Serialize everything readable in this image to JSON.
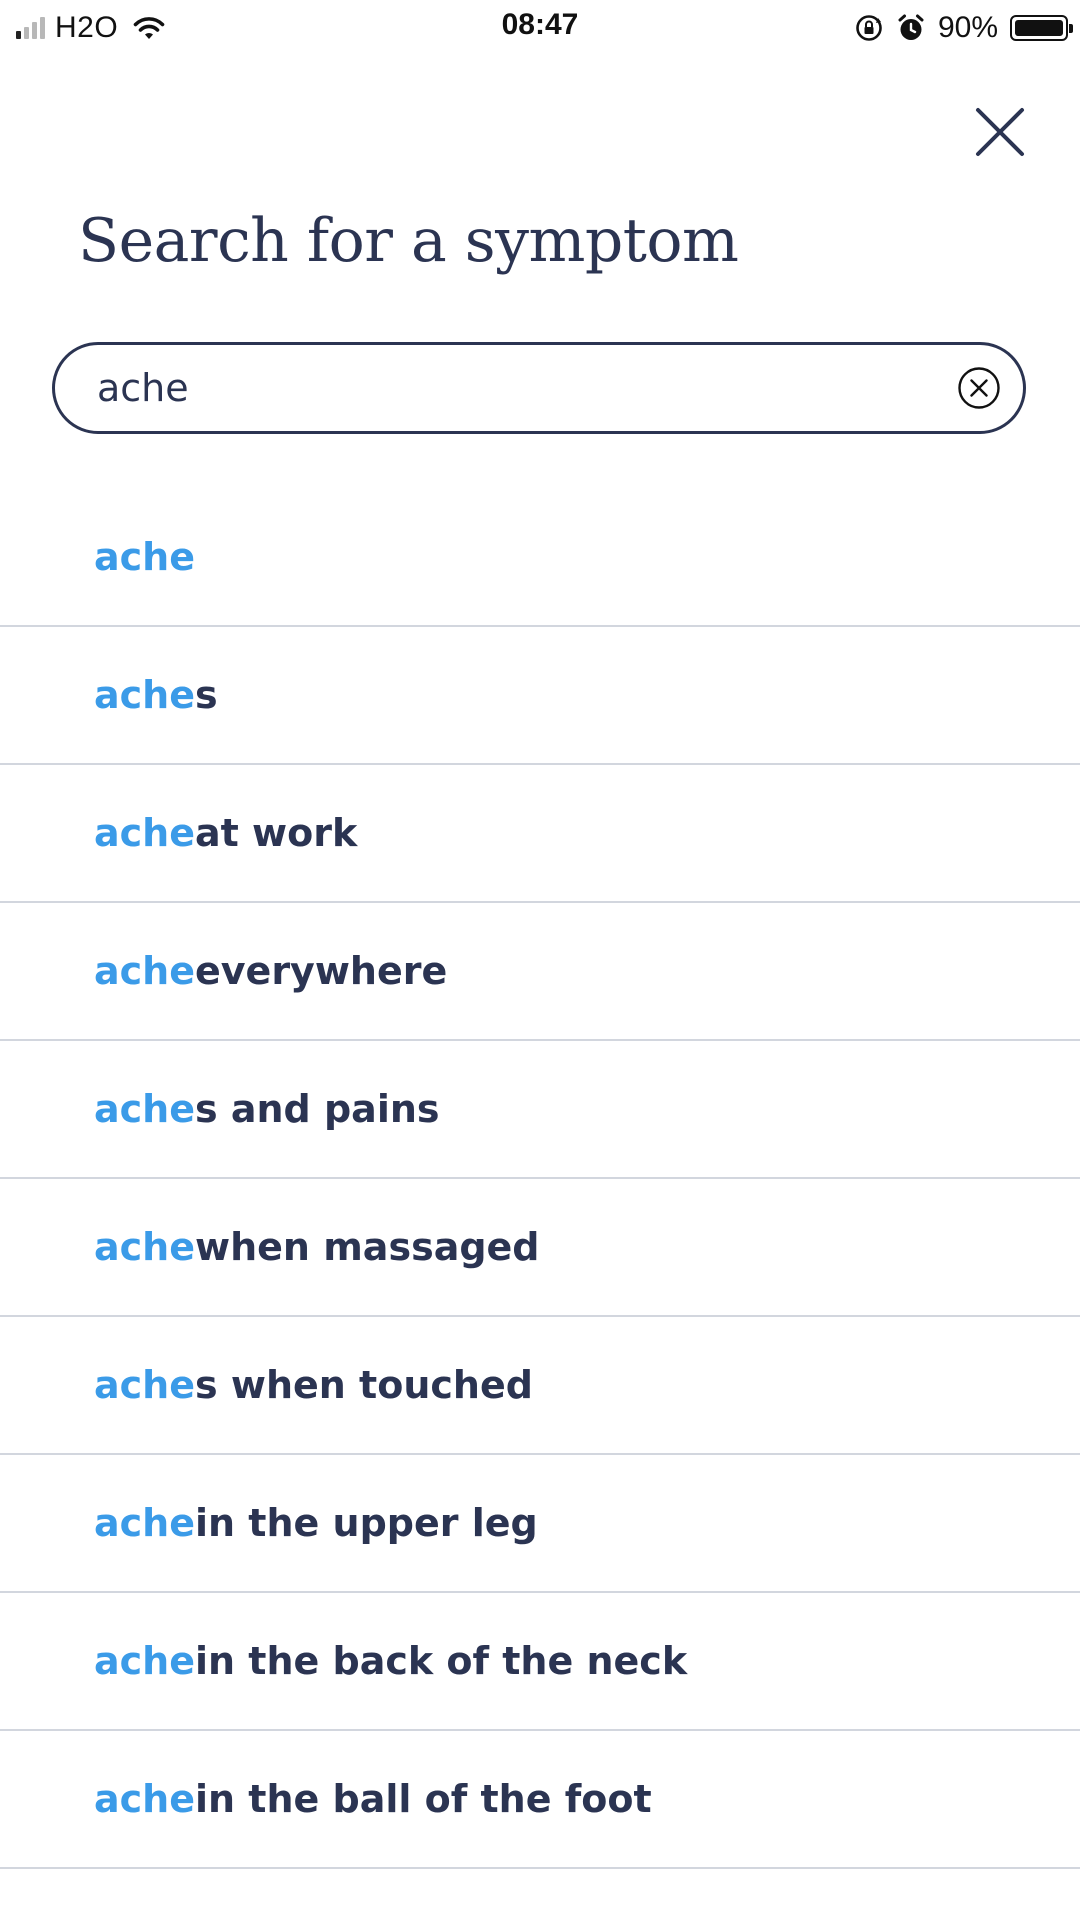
{
  "status_bar": {
    "carrier": "H2O",
    "time": "08:47",
    "battery_percent": "90%",
    "battery_level": 0.9,
    "signal_bars_active": 1,
    "signal_bars_total": 4
  },
  "header": {
    "title": "Search for a symptom"
  },
  "search": {
    "value": "ache"
  },
  "colors": {
    "match_highlight": "#3b9be8",
    "text_primary": "#2b3452",
    "divider": "#d2d6de"
  },
  "icons": {
    "close": "close-icon",
    "clear": "clear-circle-icon",
    "wifi": "wifi-icon",
    "alarm": "alarm-icon",
    "orientation_lock": "orientation-lock-icon"
  },
  "results": [
    {
      "match": "ache",
      "rest": ""
    },
    {
      "match": "ache",
      "rest": "s"
    },
    {
      "match": "ache",
      "rest": " at work"
    },
    {
      "match": "ache",
      "rest": " everywhere"
    },
    {
      "match": "ache",
      "rest": "s and pains"
    },
    {
      "match": "ache",
      "rest": " when massaged"
    },
    {
      "match": "ache",
      "rest": "s when touched"
    },
    {
      "match": "ache",
      "rest": " in the upper leg"
    },
    {
      "match": "ache",
      "rest": " in the back of the neck"
    },
    {
      "match": "ache",
      "rest": " in the ball of the foot"
    }
  ]
}
